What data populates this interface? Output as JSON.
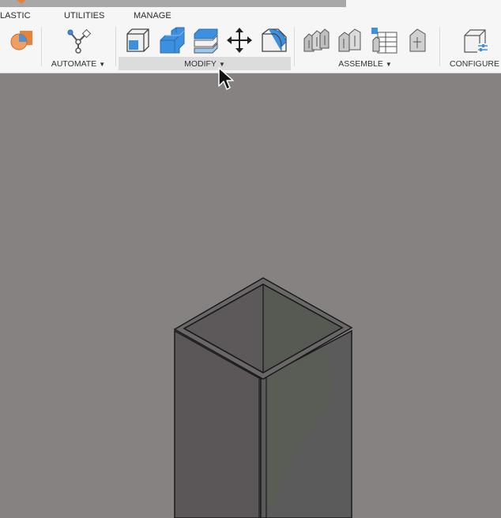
{
  "tabs": {
    "plastic": "LASTIC",
    "utilities": "UTILITIES",
    "manage": "MANAGE"
  },
  "groups": {
    "automate": "AUTOMATE",
    "modify": "MODIFY",
    "assemble": "ASSEMBLE",
    "configure": "CONFIGURE"
  },
  "colors": {
    "toolbar_bg": "#f6f6f6",
    "viewport_bg": "#858281",
    "accent_blue": "#3d8fe0",
    "accent_orange": "#e8823a",
    "model_face_left": "#5b5759",
    "model_face_right": "#5a5b5a"
  },
  "icons": {
    "plastic_tool": "plastic-rule-icon",
    "automate_tool": "automate-icon",
    "modify_tools": [
      "press-pull-icon",
      "fillet-icon",
      "shell-icon",
      "move-copy-icon",
      "chamfer-icon"
    ],
    "assemble_tools": [
      "joint-icon",
      "as-built-joint-icon",
      "table-joint-icon",
      "rigid-group-icon"
    ],
    "configure_tool": "configure-icon",
    "cursor": "mouse-pointer-icon"
  }
}
